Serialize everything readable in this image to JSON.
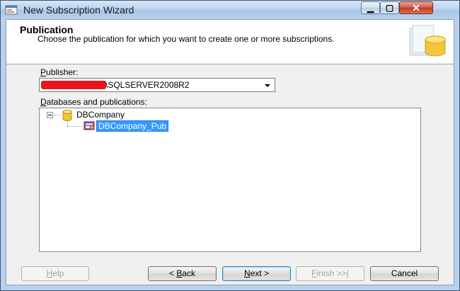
{
  "window": {
    "title": "New Subscription Wizard",
    "minimize_glyph": "▁",
    "maximize_glyph": "▢",
    "close_glyph": "✕"
  },
  "header": {
    "title": "Publication",
    "subtitle": "Choose the publication for which you want to create one or more subscriptions.",
    "icon": "database-wizard-icon"
  },
  "publisher": {
    "label_prefix": "P",
    "label_rest": "ublisher:",
    "value_suffix": "\\SQLSERVER2008R2"
  },
  "databases": {
    "label_prefix": "D",
    "label_rest": "atabases and publications:",
    "tree": [
      {
        "label": "DBCompany",
        "icon": "database-icon",
        "expanded": true,
        "children": [
          {
            "label": "DBCompany_Pub",
            "icon": "publication-icon",
            "selected": true
          }
        ]
      }
    ]
  },
  "buttons": {
    "help": {
      "u": "H",
      "rest": "elp",
      "enabled": false
    },
    "back": {
      "pre": "< ",
      "u": "B",
      "rest": "ack",
      "enabled": true
    },
    "next": {
      "u": "N",
      "rest": "ext >",
      "enabled": true
    },
    "finish": {
      "u": "F",
      "rest": "inish >>|",
      "enabled": false
    },
    "cancel": {
      "label": "Cancel",
      "enabled": true
    }
  },
  "colors": {
    "selection": "#3399ff",
    "redaction": "#e8141e"
  }
}
